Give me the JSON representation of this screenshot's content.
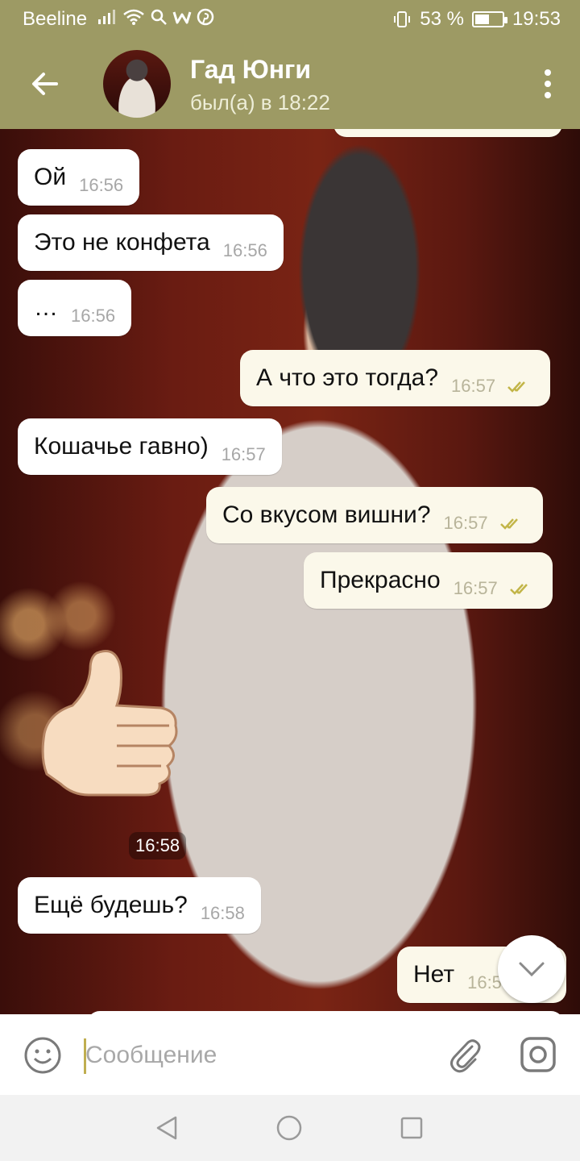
{
  "status_bar": {
    "carrier": "Beeline",
    "battery": "53 %",
    "battery_level": 0.53,
    "time": "19:53"
  },
  "header": {
    "name": "Гад Юнги",
    "status": "был(а) в 18:22"
  },
  "messages": [
    {
      "direction": "in",
      "text": "Ой",
      "time": "16:56"
    },
    {
      "direction": "in",
      "text": "Это не конфета",
      "time": "16:56"
    },
    {
      "direction": "in",
      "text": "…",
      "time": "16:56"
    },
    {
      "direction": "out",
      "text": "А что это тогда?",
      "time": "16:57",
      "read": true
    },
    {
      "direction": "in",
      "text": "Кошачье гавно)",
      "time": "16:57"
    },
    {
      "direction": "out",
      "text": "Со вкусом вишни?",
      "time": "16:57",
      "read": true
    },
    {
      "direction": "out",
      "text": "Прекрасно",
      "time": "16:57",
      "read": true
    },
    {
      "direction": "in",
      "type": "sticker",
      "sticker": "thumbs-up",
      "time": "16:58"
    },
    {
      "direction": "in",
      "text": "Ещё будешь?",
      "time": "16:58"
    },
    {
      "direction": "out",
      "text": "Нет",
      "time": "16:5"
    }
  ],
  "input": {
    "placeholder": "Сообщение"
  },
  "colors": {
    "header": "#9d9a64",
    "incoming_bubble": "#ffffff",
    "outgoing_bubble": "#fbf8ea",
    "read_check": "#c2b548"
  },
  "icons": [
    "arrow-left-icon",
    "more-vertical-icon",
    "emoji-icon",
    "paperclip-icon",
    "camera-icon",
    "chevron-down-icon"
  ]
}
